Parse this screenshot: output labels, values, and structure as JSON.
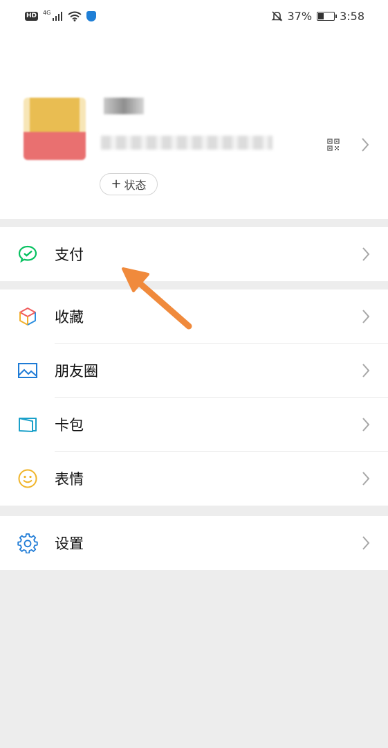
{
  "status_bar": {
    "hd": "HD",
    "network": "4G",
    "battery": "37%",
    "battery_level": 0.37,
    "time": "3:58"
  },
  "profile": {
    "nickname": "",
    "wechat_id": "",
    "status_button_label": "状态"
  },
  "menu": {
    "pay": {
      "label": "支付",
      "icon": "wechat-pay-icon",
      "color": "#07c160"
    },
    "favorites": {
      "label": "收藏",
      "icon": "cube-icon"
    },
    "moments": {
      "label": "朋友圈",
      "icon": "image-icon",
      "color": "#1e7bd6"
    },
    "cards": {
      "label": "卡包",
      "icon": "wallet-card-icon",
      "color": "#1aa0c9"
    },
    "stickers": {
      "label": "表情",
      "icon": "smiley-icon",
      "color": "#f0b428"
    },
    "settings": {
      "label": "设置",
      "icon": "gear-icon",
      "color": "#1e7bd6"
    }
  },
  "annotation": {
    "arrow_color": "#f08a3c"
  }
}
